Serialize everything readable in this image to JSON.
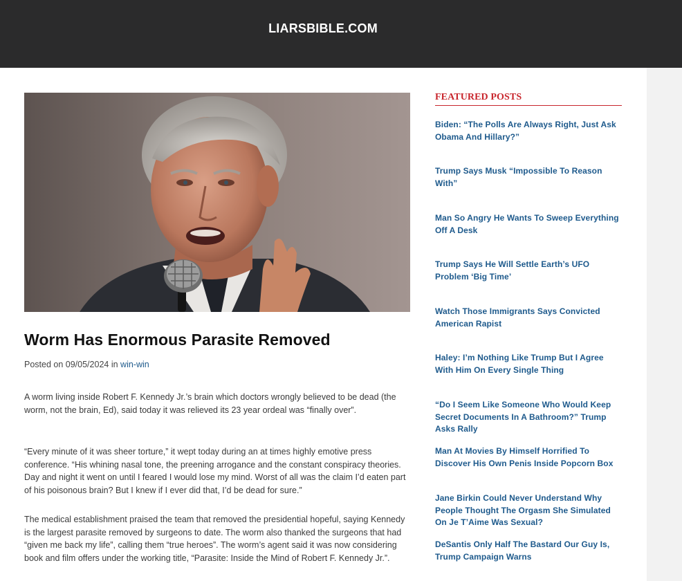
{
  "site": {
    "title": "LIARSBIBLE.COM"
  },
  "article": {
    "title": "Worm Has Enormous Parasite Removed",
    "posted_prefix": "Posted on",
    "date": "09/05/2024",
    "in_word": "in",
    "category": "win-win",
    "paragraphs": [
      "A worm living inside Robert F. Kennedy Jr.’s brain which doctors wrongly believed to be dead (the worm, not the brain, Ed), said today it was relieved its 23 year ordeal was “finally over”.",
      "“Every minute of it was sheer torture,” it wept today during an at times highly emotive press conference. “His whining nasal tone, the preening arrogance and the constant conspiracy theories. Day and night it went on until I feared I would lose my mind. Worst of all was the claim I’d eaten part of his poisonous brain? But I knew if I ever did that, I’d be dead for sure.”",
      "The medical establishment praised the team that removed the presidential hopeful, saying Kennedy is the largest parasite removed by surgeons to date. The worm also thanked the surgeons that had “given me back my life”, calling them “true heroes”. The worm’s agent said it was now considering book and film offers under the working title, “Parasite: Inside the Mind of Robert F. Kennedy Jr.”."
    ]
  },
  "sidebar": {
    "heading": "FEATURED POSTS",
    "posts": [
      "Biden: “The Polls Are Always Right, Just Ask Obama And Hillary?”",
      "Trump Says Musk “Impossible To Reason With”",
      "Man So Angry He Wants To Sweep Everything Off A Desk",
      "Trump Says He Will Settle Earth’s UFO Problem ‘Big Time’",
      "Watch Those Immigrants Says Convicted American Rapist",
      "Haley: I’m Nothing Like Trump But I Agree With Him On Every Single Thing",
      "“Do I Seem Like Someone Who Would Keep Secret Documents In A Bathroom?” Trump Asks Rally",
      "Man At Movies By Himself Horrified To Discover His Own Penis Inside Popcorn Box",
      "Jane Birkin Could Never Understand Why People Thought The Orgasm She Simulated On Je T’Aime Was Sexual?",
      "DeSantis Only Half The Bastard Our Guy Is, Trump Campaign Warns"
    ]
  },
  "colors": {
    "header_bg": "#2b2b2c",
    "link": "#1e5a8c",
    "accent_red": "#c8252c"
  }
}
